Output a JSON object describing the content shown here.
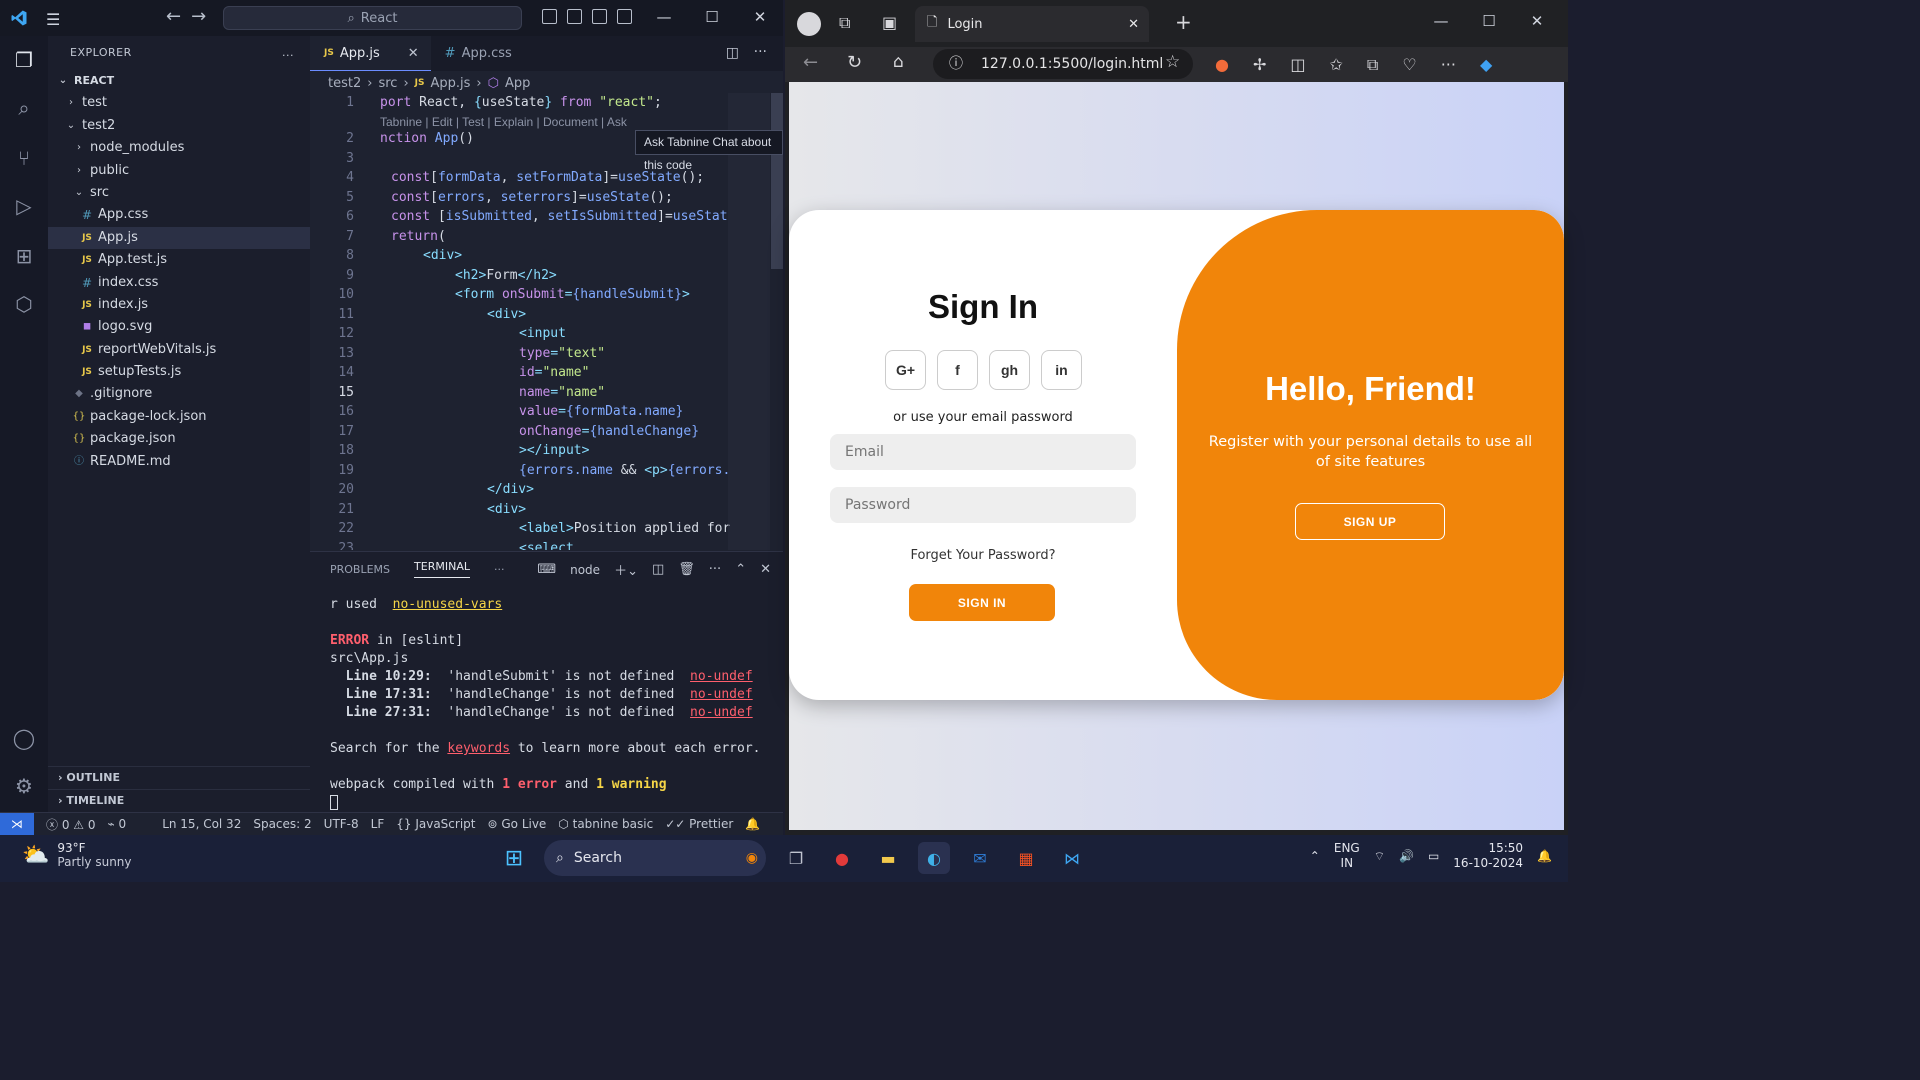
{
  "vscode": {
    "search_text": "React",
    "explorer_label": "EXPLORER",
    "explorer_more": "...",
    "tree": [
      {
        "label": "REACT",
        "indent": 0,
        "type": "root",
        "arrow": "⌄"
      },
      {
        "label": "test",
        "indent": 1,
        "type": "folder",
        "arrow": "›"
      },
      {
        "label": "test2",
        "indent": 1,
        "type": "folder",
        "arrow": "⌄"
      },
      {
        "label": "node_modules",
        "indent": 2,
        "type": "folder",
        "arrow": "›"
      },
      {
        "label": "public",
        "indent": 2,
        "type": "folder",
        "arrow": "›"
      },
      {
        "label": "src",
        "indent": 2,
        "type": "folder",
        "arrow": "⌄"
      },
      {
        "label": "App.css",
        "indent": 3,
        "type": "css"
      },
      {
        "label": "App.js",
        "indent": 3,
        "type": "js",
        "selected": true
      },
      {
        "label": "App.test.js",
        "indent": 3,
        "type": "js"
      },
      {
        "label": "index.css",
        "indent": 3,
        "type": "css"
      },
      {
        "label": "index.js",
        "indent": 3,
        "type": "js"
      },
      {
        "label": "logo.svg",
        "indent": 3,
        "type": "svg"
      },
      {
        "label": "reportWebVitals.js",
        "indent": 3,
        "type": "js"
      },
      {
        "label": "setupTests.js",
        "indent": 3,
        "type": "js"
      },
      {
        "label": ".gitignore",
        "indent": 2,
        "type": "git"
      },
      {
        "label": "package-lock.json",
        "indent": 2,
        "type": "json"
      },
      {
        "label": "package.json",
        "indent": 2,
        "type": "json"
      },
      {
        "label": "README.md",
        "indent": 2,
        "type": "info"
      }
    ],
    "outline_label": "OUTLINE",
    "timeline_label": "TIMELINE",
    "tabs": [
      {
        "label": "App.js",
        "active": true
      },
      {
        "label": "App.css",
        "active": false
      }
    ],
    "breadcrumb": [
      "test2",
      "src",
      "App.js",
      "App"
    ],
    "tooltip": "Ask Tabnine Chat about this code",
    "codelens": "Tabnine | Edit | Test | Explain | Document | Ask",
    "panel_tabs": [
      "PROBLEMS",
      "TERMINAL"
    ],
    "panel_more": "···",
    "terminal_shell": "node",
    "status": {
      "errors": "0",
      "warnings": "0",
      "ports": "0",
      "position": "Ln 15, Col 32",
      "spaces": "Spaces: 2",
      "encoding": "UTF-8",
      "eol": "LF",
      "language": "JavaScript",
      "golive": "Go Live",
      "tabnine": "tabnine basic",
      "prettier": "Prettier"
    }
  },
  "code": {
    "line_numbers": [
      "1",
      "",
      "2",
      "3",
      "4",
      "5",
      "6",
      "7",
      "8",
      "9",
      "10",
      "11",
      "12",
      "13",
      "14",
      "15",
      "16",
      "17",
      "18",
      "19",
      "20",
      "21",
      "22",
      "23"
    ],
    "current_line": "15"
  },
  "terminal": {
    "used_prefix": "r used  ",
    "used_rule": "no-unused-vars",
    "error_word": "ERROR",
    "error_rest": " in [eslint]",
    "file": "src\\App.js",
    "errors": [
      {
        "loc": "Line 10:29:",
        "msg": "'handleSubmit' is not defined",
        "rule": "no-undef"
      },
      {
        "loc": "Line 17:31:",
        "msg": "'handleChange' is not defined",
        "rule": "no-undef"
      },
      {
        "loc": "Line 27:31:",
        "msg": "'handleChange' is not defined",
        "rule": "no-undef"
      }
    ],
    "search_pre": "Search for the ",
    "search_link": "keywords",
    "search_post": " to learn more about each error.",
    "compiled_pre": "webpack compiled with ",
    "compiled_err": "1 error",
    "compiled_mid": " and ",
    "compiled_warn": "1 warning"
  },
  "browser": {
    "tab_title": "Login",
    "url": "127.0.0.1:5500/login.html"
  },
  "login": {
    "title": "Sign In",
    "socials": [
      "G+",
      "f",
      "gh",
      "in"
    ],
    "or_text": "or use your email password",
    "email_placeholder": "Email",
    "password_placeholder": "Password",
    "forgot": "Forget Your Password?",
    "signin_button": "SIGN IN",
    "hello_title": "Hello, Friend!",
    "register_text": "Register with your personal details to use all of site features",
    "signup_button": "SIGN UP"
  },
  "taskbar": {
    "temp": "93°F",
    "weather": "Partly sunny",
    "search": "Search",
    "lang1": "ENG",
    "lang2": "IN",
    "time": "15:50",
    "date": "16-10-2024"
  },
  "colors": {
    "accent_orange": "#f1850a",
    "vscode_bg": "#1e2230",
    "taskbar_bg": "#1a2038"
  }
}
